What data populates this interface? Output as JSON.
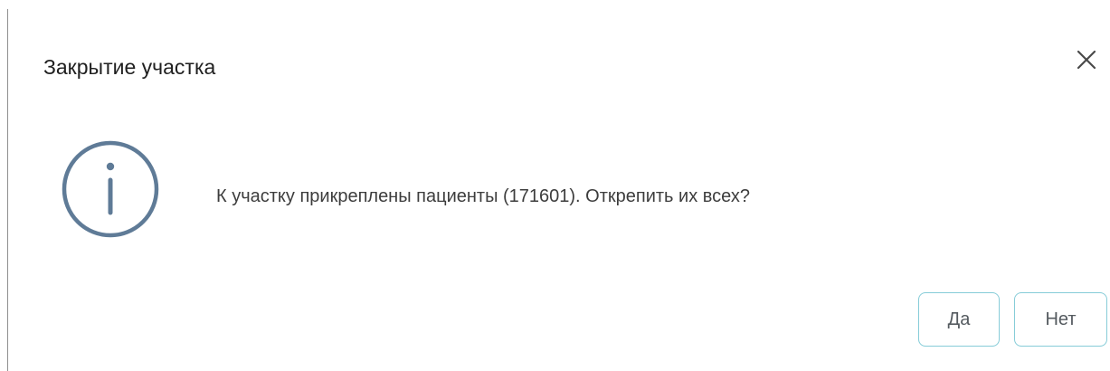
{
  "dialog": {
    "title": "Закрытие участка",
    "close_icon": "close-icon",
    "status_icon": "info-icon",
    "message": "К участку прикреплены пациенты (171601). Открепить их всех?",
    "buttons": {
      "yes_label": "Да",
      "no_label": "Нет"
    }
  },
  "colors": {
    "title_text": "#202020",
    "message_text": "#3d3d3d",
    "icon_stroke": "#5f7b97",
    "button_border": "#86ccd8",
    "button_text": "#555b60"
  }
}
